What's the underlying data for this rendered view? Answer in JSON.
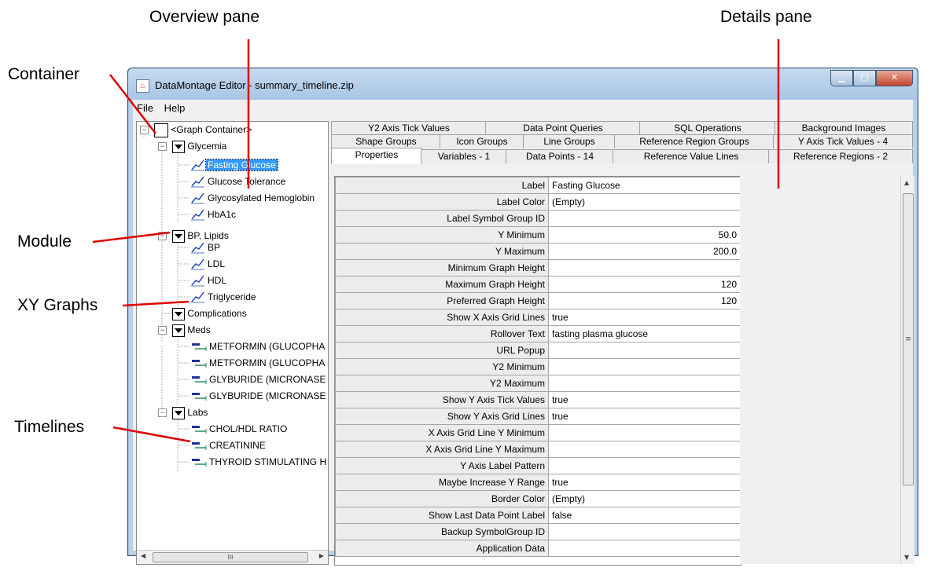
{
  "annotations": {
    "overview": "Overview pane",
    "details": "Details pane",
    "container": "Container",
    "module": "Module",
    "xy_graphs": "XY Graphs",
    "timelines": "Timelines"
  },
  "window": {
    "title": "DataMontage Editor - summary_timeline.zip",
    "menu": [
      "File",
      "Help"
    ]
  },
  "tree": {
    "root": "<Graph Container>",
    "glycemia": "Glycemia",
    "fasting_glucose": "Fasting Glucose",
    "glucose_tolerance": "Glucose Tolerance",
    "glycosylated_hemoglobin": "Glycosylated Hemoglobin",
    "hba1c": "HbA1c",
    "bp_lipids": "BP, Lipids",
    "bp": "BP",
    "ldl": "LDL",
    "hdl": "HDL",
    "triglyceride": "Triglyceride",
    "complications": "Complications",
    "meds": "Meds",
    "metformin_1": "METFORMIN (GLUCOPHA",
    "metformin_2": "METFORMIN (GLUCOPHA",
    "glyburide_1": "GLYBURIDE (MICRONASE",
    "glyburide_2": "GLYBURIDE (MICRONASE",
    "labs": "Labs",
    "chol_hdl": "CHOL/HDL RATIO",
    "creatinine": "CREATININE",
    "thyroid": "THYROID STIMULATING H",
    "hscroll_grip": "III"
  },
  "tabs": {
    "row1": [
      "Y2 Axis Tick Values",
      "Data Point Queries",
      "SQL Operations",
      "Background Images"
    ],
    "row2": [
      "Shape Groups",
      "Icon Groups",
      "Line Groups",
      "Reference Region Groups",
      "Y Axis Tick Values - 4"
    ],
    "row3": [
      "Properties",
      "Variables - 1",
      "Data Points - 14",
      "Reference Value Lines",
      "Reference Regions - 2"
    ]
  },
  "properties": [
    {
      "k": "Label",
      "v": "Fasting Glucose"
    },
    {
      "k": "Label Color",
      "v": "(Empty)"
    },
    {
      "k": "Label Symbol Group ID",
      "v": ""
    },
    {
      "k": "Y Minimum",
      "v": "50.0"
    },
    {
      "k": "Y Maximum",
      "v": "200.0"
    },
    {
      "k": "Minimum Graph Height",
      "v": ""
    },
    {
      "k": "Maximum Graph Height",
      "v": "120"
    },
    {
      "k": "Preferred Graph Height",
      "v": "120"
    },
    {
      "k": "Show X Axis Grid Lines",
      "v": "true"
    },
    {
      "k": "Rollover Text",
      "v": "fasting plasma glucose"
    },
    {
      "k": "URL Popup",
      "v": ""
    },
    {
      "k": "Y2 Minimum",
      "v": ""
    },
    {
      "k": "Y2 Maximum",
      "v": ""
    },
    {
      "k": "Show Y Axis Tick Values",
      "v": "true"
    },
    {
      "k": "Show Y Axis Grid Lines",
      "v": "true"
    },
    {
      "k": "X Axis Grid Line Y Minimum",
      "v": ""
    },
    {
      "k": "X Axis Grid Line Y Maximum",
      "v": ""
    },
    {
      "k": "Y Axis Label Pattern",
      "v": ""
    },
    {
      "k": "Maybe Increase Y Range",
      "v": "true"
    },
    {
      "k": "Border Color",
      "v": "(Empty)"
    },
    {
      "k": "Show Last Data Point Label",
      "v": "false"
    },
    {
      "k": "Backup SymbolGroup ID",
      "v": ""
    },
    {
      "k": "Application Data",
      "v": ""
    }
  ],
  "vscroll_grip": "≡"
}
